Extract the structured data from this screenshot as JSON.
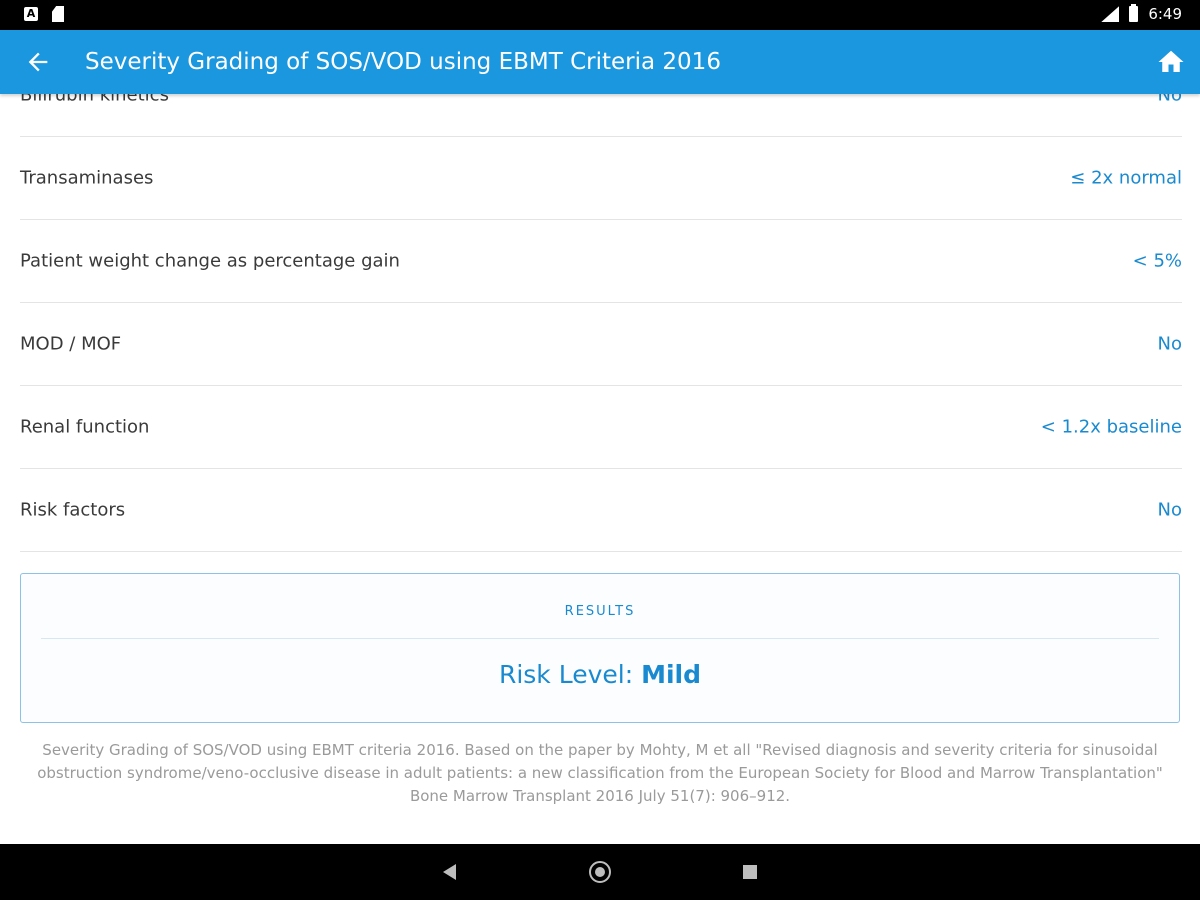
{
  "status_bar": {
    "time": "6:49",
    "icons": [
      "a-icon",
      "sd-card-icon",
      "signal-icon",
      "battery-icon"
    ]
  },
  "app_bar": {
    "title": "Severity Grading of SOS/VOD using EBMT Criteria 2016",
    "back_icon": "arrow-back-icon",
    "home_icon": "home-icon",
    "background_color": "#1a97df"
  },
  "rows": [
    {
      "label": "Bilirubin kinetics",
      "value": "No"
    },
    {
      "label": "Transaminases",
      "value": "≤ 2x normal"
    },
    {
      "label": "Patient weight change as percentage gain",
      "value": "< 5%"
    },
    {
      "label": "MOD / MOF",
      "value": "No"
    },
    {
      "label": "Renal function",
      "value": "< 1.2x baseline"
    },
    {
      "label": "Risk factors",
      "value": "No"
    }
  ],
  "results": {
    "title": "RESULTS",
    "label": "Risk Level:",
    "value": "Mild"
  },
  "citation": "Severity Grading of SOS/VOD using EBMT criteria 2016. Based on the paper by Mohty, M et all \"Revised diagnosis and severity criteria for sinusoidal obstruction syndrome/veno-occlusive disease in adult patients: a new classification from the European Society for Blood and Marrow Transplantation\" Bone Marrow Transplant 2016 July 51(7): 906–912.",
  "colors": {
    "accent": "#1a8ad0",
    "label_text": "#3a3a3a",
    "citation_text": "#9a9a9a"
  }
}
